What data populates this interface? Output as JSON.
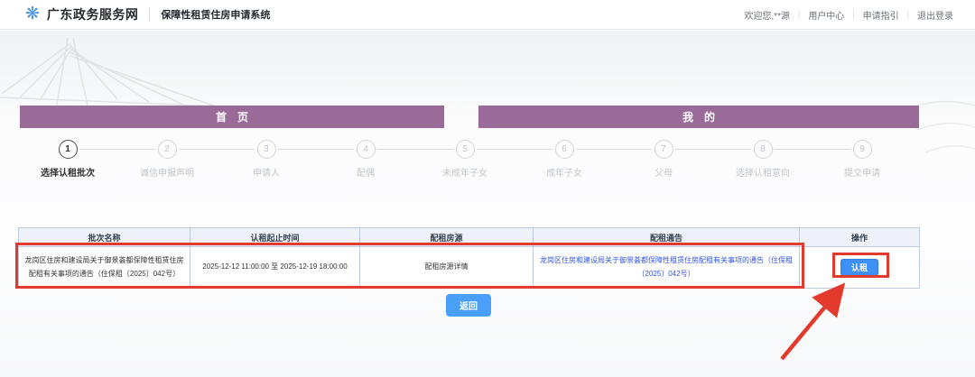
{
  "header": {
    "logo_icon": "gov-flower-icon",
    "site_name": "广东政务服务网",
    "system_name": "保障性租赁住房申请系统",
    "welcome": "欢迎您,**源",
    "links": [
      {
        "label": "用户中心"
      },
      {
        "label": "申请指引"
      },
      {
        "label": "退出登录"
      }
    ]
  },
  "sections": {
    "home_tab": "首　页",
    "mine_tab": "我　的"
  },
  "steps": [
    {
      "num": "1",
      "label": "选择认租批次",
      "active": true
    },
    {
      "num": "2",
      "label": "诚信申报声明",
      "active": false
    },
    {
      "num": "3",
      "label": "申请人",
      "active": false
    },
    {
      "num": "4",
      "label": "配偶",
      "active": false
    },
    {
      "num": "5",
      "label": "未成年子女",
      "active": false
    },
    {
      "num": "6",
      "label": "成年子女",
      "active": false
    },
    {
      "num": "7",
      "label": "父母",
      "active": false
    },
    {
      "num": "8",
      "label": "选择认租意向",
      "active": false
    },
    {
      "num": "9",
      "label": "提交申请",
      "active": false
    }
  ],
  "table": {
    "columns": [
      "批次名称",
      "认租起止时间",
      "配租房源",
      "配租通告",
      "操作"
    ],
    "rows": [
      {
        "batch_name": "龙岗区住房和建设局关于御景荟都保障性租赁住房配租有关事项的通告（住保租〔2025〕042号）",
        "time_range": "2025-12-12 11:00:00 至 2025-12-19 18:00:00",
        "housing_link": "配租房源详情",
        "notice_link": "龙岗区住房和建设局关于御景荟都保障性租赁住房配租有关事项的通告（住保租〔2025〕042号）",
        "action_label": "认租"
      }
    ]
  },
  "buttons": {
    "back": "返回"
  },
  "colors": {
    "banner_purple": "#9a6b98",
    "primary_blue": "#3f90f5",
    "link_blue": "#2f54eb",
    "table_border": "#bccbdf",
    "annotation_red": "#e23b2e"
  }
}
